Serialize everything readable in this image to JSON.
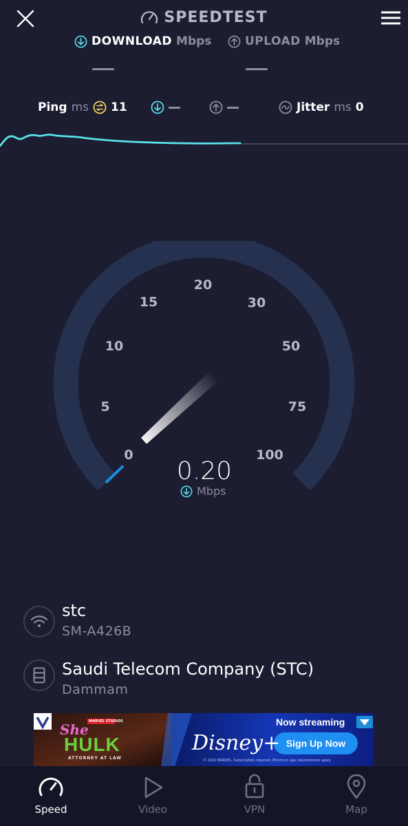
{
  "header": {
    "title": "SPEEDTEST"
  },
  "tabs": {
    "download": {
      "label": "DOWNLOAD",
      "unit": "Mbps"
    },
    "upload": {
      "label": "UPLOAD",
      "unit": "Mbps"
    }
  },
  "stats": {
    "ping": {
      "label": "Ping",
      "unit": "ms",
      "value": "11"
    },
    "jitter": {
      "label": "Jitter",
      "unit": "ms",
      "value": "0"
    }
  },
  "gauge": {
    "ticks": [
      "0",
      "5",
      "10",
      "15",
      "20",
      "30",
      "50",
      "75",
      "100"
    ],
    "value": "0.20",
    "unit": "Mbps"
  },
  "connection": {
    "provider": "stc",
    "device": "SM-A426B"
  },
  "server": {
    "name": "Saudi Telecom Company (STC)",
    "location": "Dammam"
  },
  "ad": {
    "brand_small": "MARVEL STUDIOS",
    "show_title_1": "She",
    "show_title_2": "HULK",
    "show_subtitle": "ATTORNEY AT LAW",
    "streaming_label": "Now streaming",
    "service": "Disney+",
    "cta": "Sign Up Now",
    "fine_print": "© 2022 MARVEL. Subscription required. Minimum age requirements apply."
  },
  "nav": [
    {
      "label": "Speed",
      "icon": "speedometer-icon"
    },
    {
      "label": "Video",
      "icon": "play-icon"
    },
    {
      "label": "VPN",
      "icon": "lock-icon"
    },
    {
      "label": "Map",
      "icon": "map-pin-icon"
    }
  ],
  "colors": {
    "background": "#1c1d31",
    "accent_cyan": "#59d9e8",
    "gauge_track": "#26314f",
    "gauge_fill": "#1b8ae0"
  }
}
